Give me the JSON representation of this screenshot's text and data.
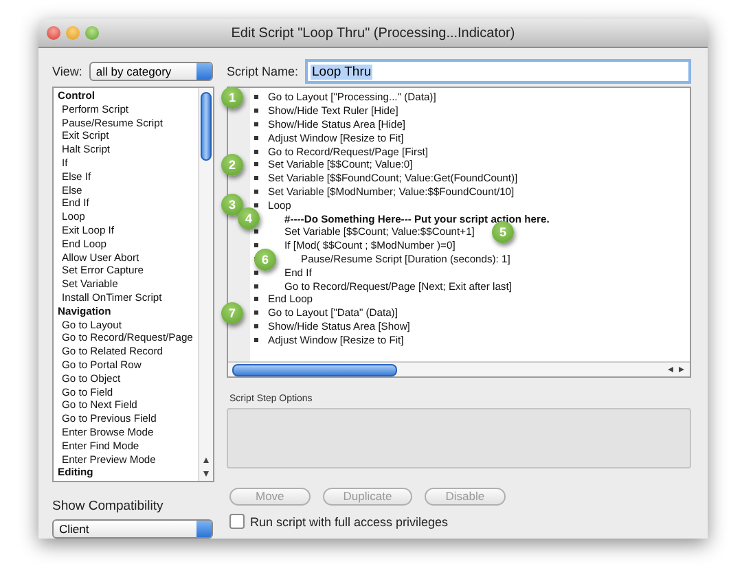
{
  "window": {
    "title": "Edit Script \"Loop Thru\" (Processing...Indicator)"
  },
  "view": {
    "label": "View:",
    "value": "all by category"
  },
  "steps_list": [
    {
      "kind": "category",
      "label": "Control"
    },
    {
      "kind": "step",
      "label": "Perform Script"
    },
    {
      "kind": "step",
      "label": "Pause/Resume Script"
    },
    {
      "kind": "step",
      "label": "Exit Script"
    },
    {
      "kind": "step",
      "label": "Halt Script"
    },
    {
      "kind": "step",
      "label": "If"
    },
    {
      "kind": "step",
      "label": "Else If"
    },
    {
      "kind": "step",
      "label": "Else"
    },
    {
      "kind": "step",
      "label": "End If"
    },
    {
      "kind": "step",
      "label": "Loop"
    },
    {
      "kind": "step",
      "label": "Exit Loop If"
    },
    {
      "kind": "step",
      "label": "End Loop"
    },
    {
      "kind": "step",
      "label": "Allow User Abort"
    },
    {
      "kind": "step",
      "label": "Set Error Capture"
    },
    {
      "kind": "step",
      "label": "Set Variable"
    },
    {
      "kind": "step",
      "label": "Install OnTimer Script"
    },
    {
      "kind": "category",
      "label": "Navigation"
    },
    {
      "kind": "step",
      "label": "Go to Layout"
    },
    {
      "kind": "step",
      "label": "Go to Record/Request/Page"
    },
    {
      "kind": "step",
      "label": "Go to Related Record"
    },
    {
      "kind": "step",
      "label": "Go to Portal Row"
    },
    {
      "kind": "step",
      "label": "Go to Object"
    },
    {
      "kind": "step",
      "label": "Go to Field"
    },
    {
      "kind": "step",
      "label": "Go to Next Field"
    },
    {
      "kind": "step",
      "label": "Go to Previous Field"
    },
    {
      "kind": "step",
      "label": "Enter Browse Mode"
    },
    {
      "kind": "step",
      "label": "Enter Find Mode"
    },
    {
      "kind": "step",
      "label": "Enter Preview Mode"
    },
    {
      "kind": "category",
      "label": "Editing"
    }
  ],
  "compatibility": {
    "label": "Show Compatibility",
    "value": "Client"
  },
  "script_name": {
    "label": "Script Name:",
    "value": "Loop Thru"
  },
  "script": [
    {
      "kind": "step",
      "text": "Go to Layout [\"Processing...\" (Data)]",
      "badge": "1",
      "badge_after_text": false
    },
    {
      "kind": "step",
      "text": "Show/Hide Text Ruler [Hide]"
    },
    {
      "kind": "step",
      "text": "Show/Hide Status Area [Hide]"
    },
    {
      "kind": "step",
      "text": "Adjust Window [Resize to Fit]"
    },
    {
      "kind": "step",
      "text": "Go to Record/Request/Page [First]"
    },
    {
      "kind": "step",
      "text": "Set Variable [$$Count; Value:0]",
      "badge": "2",
      "badge_after_text": false
    },
    {
      "kind": "step",
      "text": "Set Variable [$$FoundCount; Value:Get(FoundCount)]"
    },
    {
      "kind": "step",
      "text": "Set Variable [$ModNumber; Value:$$FoundCount/10]"
    },
    {
      "kind": "step",
      "text": "Loop",
      "badge": "3",
      "badge_after_text": false,
      "children": [
        {
          "kind": "comment",
          "text": "#----Do Something Here--- Put your script action here.",
          "badge": "4",
          "badge_after_text": false
        },
        {
          "kind": "step",
          "text": "Set Variable [$$Count; Value:$$Count+1]",
          "badge": "5",
          "badge_after_text": true
        },
        {
          "kind": "step",
          "text": "If [Mod( $$Count ; $ModNumber )=0]",
          "children": [
            {
              "kind": "step",
              "text": "Pause/Resume Script [Duration (seconds): 1]",
              "badge": "6",
              "badge_after_text": false
            }
          ]
        },
        {
          "kind": "step",
          "text": "End If"
        },
        {
          "kind": "step",
          "text": "Go to Record/Request/Page [Next; Exit after last]"
        }
      ]
    },
    {
      "kind": "step",
      "text": "End Loop"
    },
    {
      "kind": "step",
      "text": "Go to Layout [\"Data\" (Data)]",
      "badge": "7",
      "badge_after_text": false
    },
    {
      "kind": "step",
      "text": "Show/Hide Status Area [Show]"
    },
    {
      "kind": "step",
      "text": "Adjust Window [Resize to Fit]"
    }
  ],
  "options": {
    "label": "Script Step Options"
  },
  "buttons": [
    {
      "label": "Move",
      "disabled": true
    },
    {
      "label": "Duplicate",
      "disabled": true
    },
    {
      "label": "Disable",
      "disabled": true
    }
  ],
  "full_access": {
    "label": "Run script with full access privileges",
    "checked": false
  }
}
